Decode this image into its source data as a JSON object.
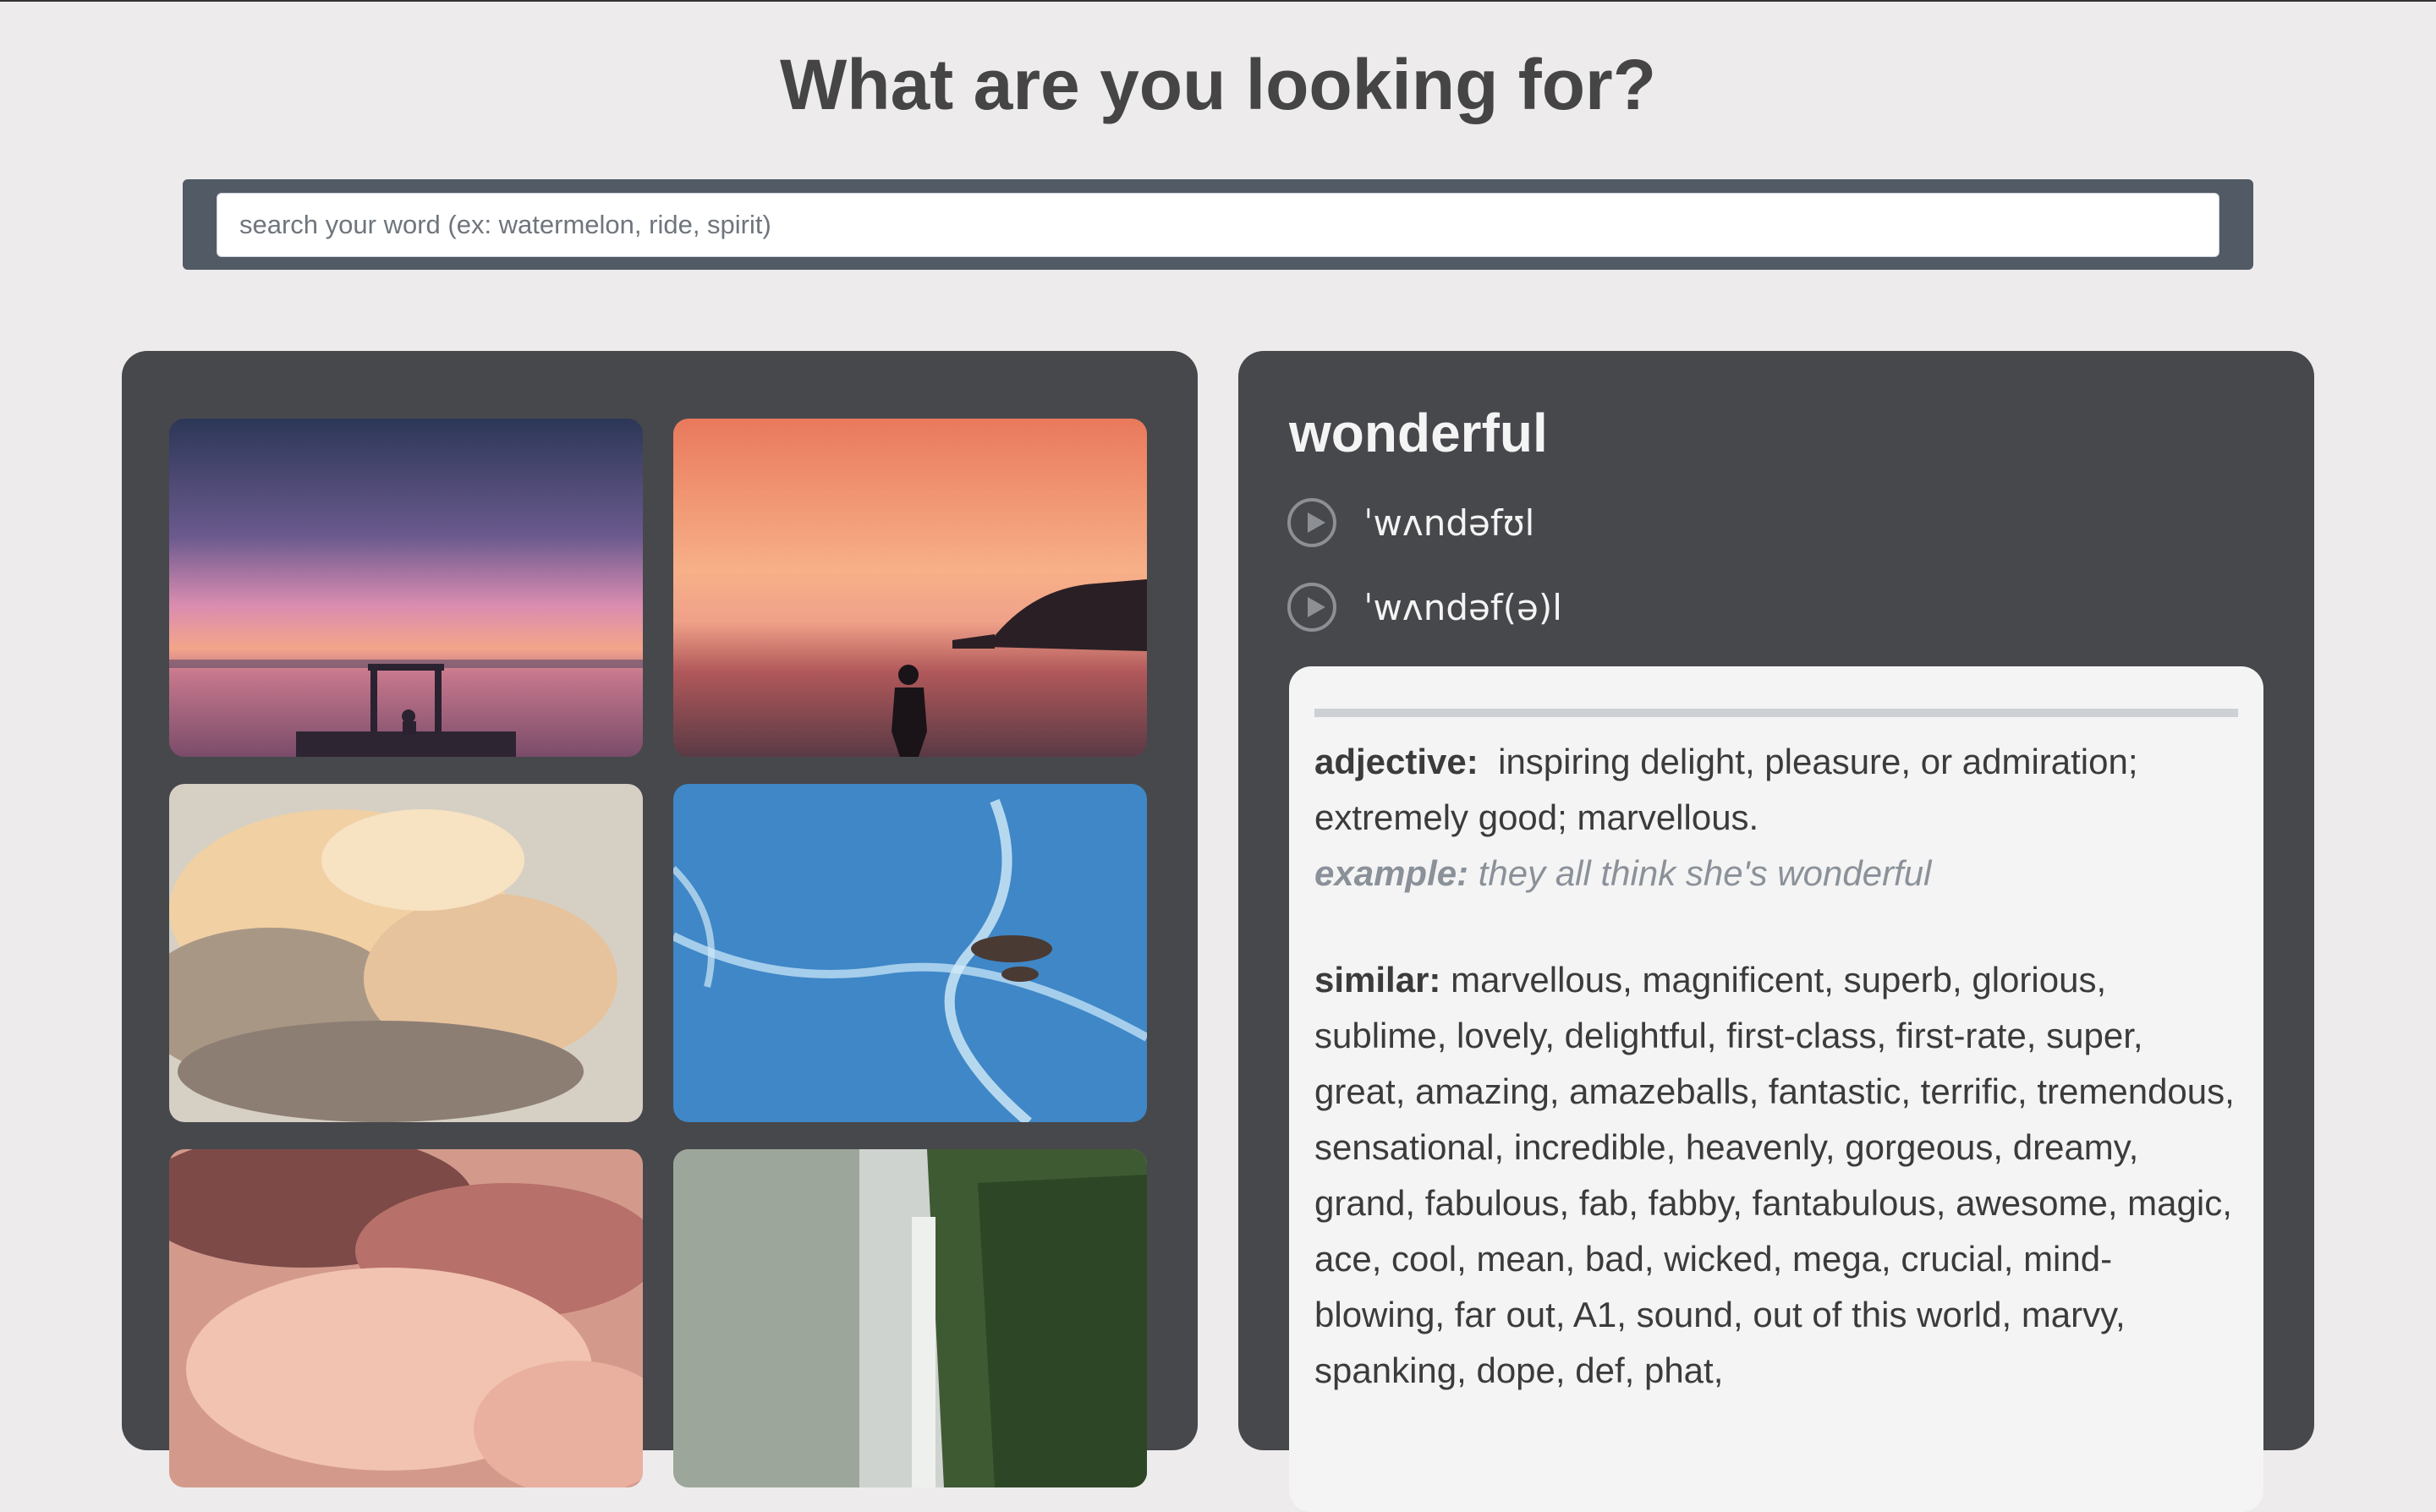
{
  "header": {
    "title": "What are you looking for?"
  },
  "search": {
    "placeholder": "search your word (ex: watermelon, ride, spirit)",
    "value": ""
  },
  "gallery": {
    "photos": [
      {
        "subject": "starry pink sunset over a pier with a seated figure"
      },
      {
        "subject": "person silhouetted at an orange sunset over the sea"
      },
      {
        "subject": "golden cumulus clouds"
      },
      {
        "subject": "aerial view of blue ocean with rocks"
      },
      {
        "subject": "pink clouds at dusk"
      },
      {
        "subject": "misty waterfall in a green jungle"
      }
    ]
  },
  "definition": {
    "word": "wonderful",
    "phonetics": [
      {
        "text": "ˈwʌndəfʊl",
        "icon": "play-icon"
      },
      {
        "text": "ˈwʌndəf(ə)l",
        "icon": "play-icon"
      }
    ],
    "part_of_speech_label": "adjective:",
    "meaning": "inspiring delight, pleasure, or admiration; extremely good; marvellous.",
    "example_label": "example:",
    "example": "they all think she's wonderful",
    "similar_label": "similar:",
    "similar": "marvellous, magnificent, superb, glorious, sublime, lovely, delightful, first-class, first-rate, super, great, amazing, amazeballs, fantastic, terrific, tremendous, sensational, incredible, heavenly, gorgeous, dreamy, grand, fabulous, fab, fabby, fantabulous, awesome, magic, ace, cool, mean, bad, wicked, mega, crucial, mind-blowing, far out, A1, sound, out of this world, marvy, spanking, dope, def, phat,"
  },
  "colors": {
    "background": "#edebec",
    "panel": "#47484c",
    "search_bar": "#515a65",
    "card": "#f4f4f4",
    "example_text": "#8b9199"
  }
}
